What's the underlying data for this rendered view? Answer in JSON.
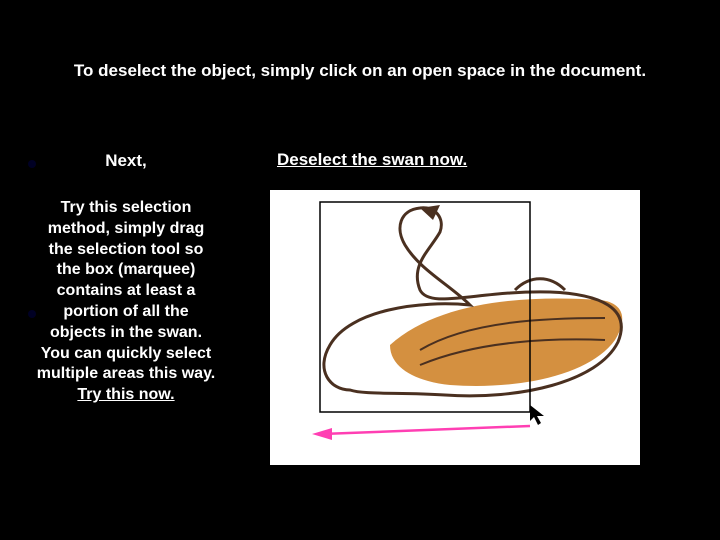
{
  "heading": "To deselect the object, simply click on an open space in the document.",
  "sub_instruction": "Deselect the swan now.",
  "left": {
    "next": "Next,",
    "body_before": "Try this selection method, simply drag the selection tool so the box (marquee) contains at least a portion of all the objects in the swan.  You can quickly select multiple areas this way.  ",
    "try_now": "Try this now."
  },
  "colors": {
    "swan_fill": "#d49040",
    "swan_outline": "#4a3020",
    "arrow": "#ff3fb3",
    "marquee": "#000000"
  },
  "icons": {
    "swan": "swan-illustration",
    "arrow": "arrow-left-icon",
    "cursor": "cursor-arrow-icon"
  }
}
